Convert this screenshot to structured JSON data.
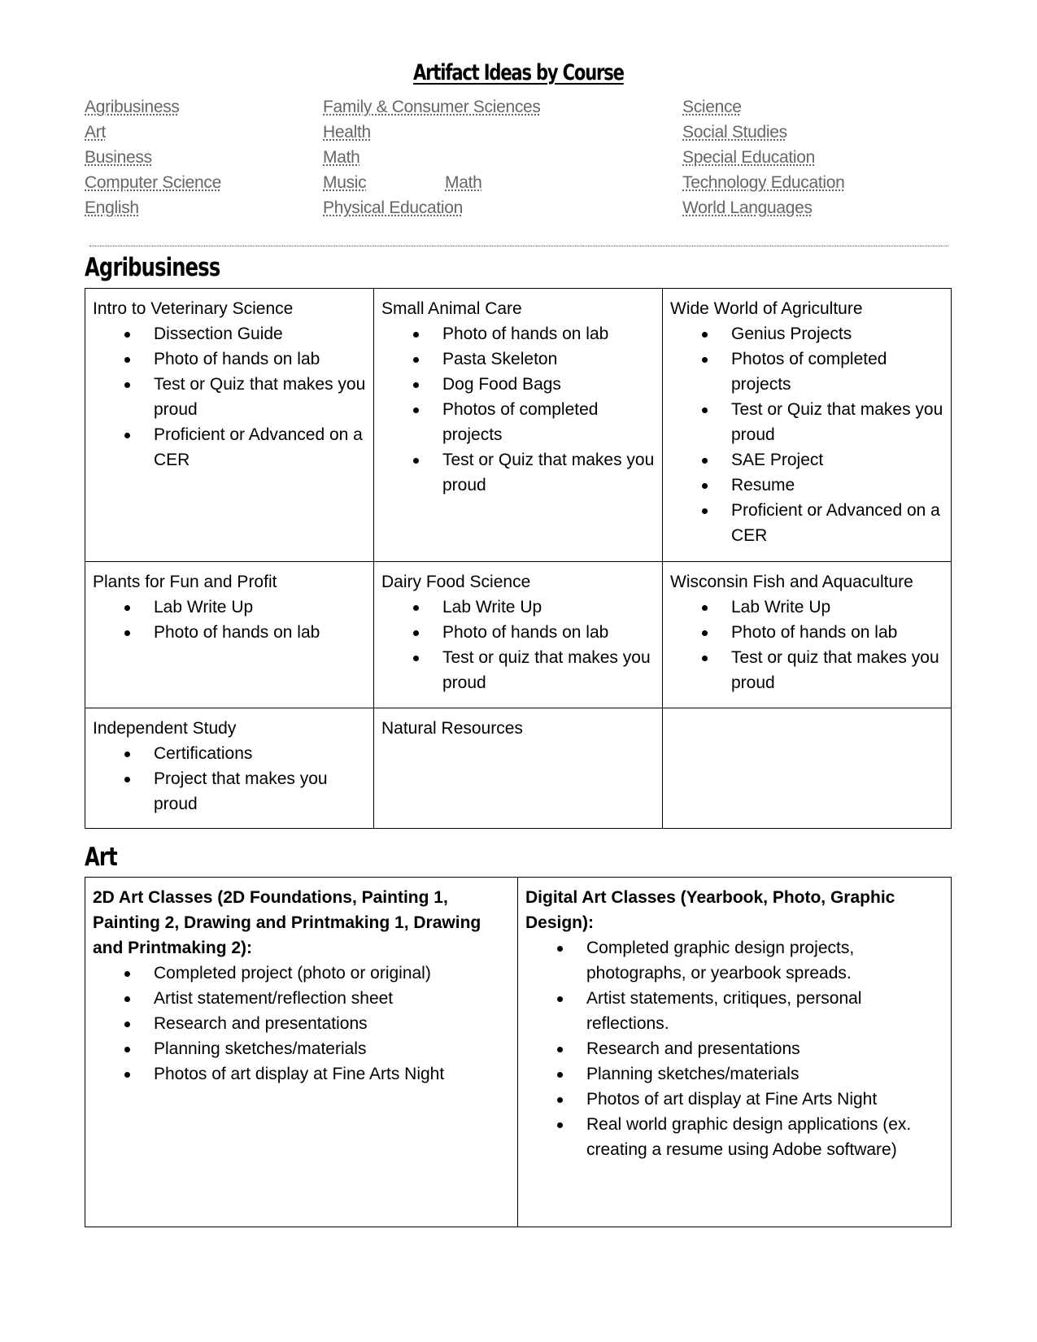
{
  "title": "Artifact Ideas by Course",
  "toc": {
    "col1": [
      "Agribusiness",
      "Art",
      "Business",
      "Computer Science",
      "English"
    ],
    "col2": [
      "Family & Consumer Sciences",
      "Health",
      "Math",
      "Music",
      "Physical Education"
    ],
    "col2_extra": "Math",
    "col3": [
      "Science",
      "Social Studies",
      "Special Education",
      "Technology Education",
      "World Languages"
    ]
  },
  "sections": {
    "agribusiness": {
      "heading": "Agribusiness",
      "cells": [
        {
          "title": "Intro to Veterinary Science",
          "items": [
            "Dissection Guide",
            "Photo of hands on lab",
            "Test or Quiz that makes you proud",
            "Proficient or Advanced on a CER"
          ]
        },
        {
          "title": "Small Animal Care",
          "items": [
            "Photo of hands on lab",
            "Pasta Skeleton",
            "Dog Food Bags",
            "Photos of completed projects",
            "Test or Quiz that makes you proud"
          ]
        },
        {
          "title": "Wide World of Agriculture",
          "items": [
            "Genius Projects",
            "Photos of completed projects",
            "Test or Quiz that makes you proud",
            "SAE Project",
            "Resume",
            "Proficient or Advanced on a CER"
          ]
        },
        {
          "title": "Plants for Fun and Profit",
          "items": [
            "Lab Write Up",
            "Photo of hands on lab"
          ]
        },
        {
          "title": "Dairy Food Science",
          "items": [
            "Lab Write Up",
            "Photo of hands on lab",
            "Test or quiz that makes you proud"
          ]
        },
        {
          "title": "Wisconsin Fish and Aquaculture",
          "items": [
            "Lab Write Up",
            "Photo of hands on lab",
            "Test or quiz that makes you proud"
          ]
        },
        {
          "title": "Independent Study",
          "items": [
            "Certifications",
            "Project that makes you proud"
          ]
        },
        {
          "title": "Natural Resources",
          "items": []
        },
        {
          "title": "",
          "items": []
        }
      ]
    },
    "art": {
      "heading": "Art",
      "cells": [
        {
          "title": "2D Art Classes (2D Foundations, Painting 1, Painting 2, Drawing and Printmaking 1, Drawing and Printmaking 2):",
          "items": [
            "Completed project (photo or original)",
            "Artist statement/reflection sheet",
            "Research and presentations",
            "Planning sketches/materials",
            "Photos of art display at Fine Arts Night"
          ]
        },
        {
          "title": "Digital Art Classes (Yearbook, Photo, Graphic Design):",
          "items": [
            "Completed graphic design projects, photographs, or yearbook spreads.",
            "Artist statements, critiques, personal reflections.",
            "Research and presentations",
            "Planning sketches/materials",
            "Photos of art display at Fine Arts Night",
            "Real world graphic design applications (ex. creating a resume using Adobe software)"
          ]
        }
      ]
    }
  }
}
